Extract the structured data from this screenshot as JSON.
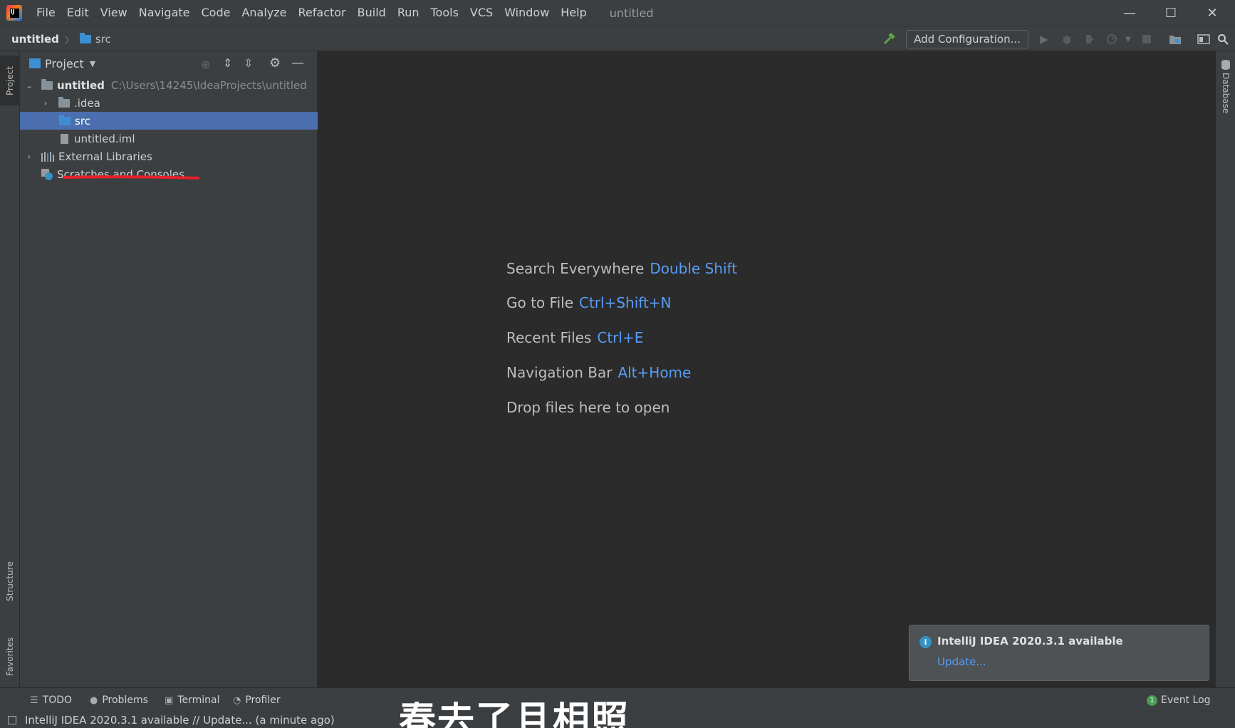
{
  "titlebar": {
    "menu": [
      "File",
      "Edit",
      "View",
      "Navigate",
      "Code",
      "Analyze",
      "Refactor",
      "Build",
      "Run",
      "Tools",
      "VCS",
      "Window",
      "Help"
    ],
    "project_title": "untitled",
    "controls": {
      "minimize": "—",
      "maximize": "☐",
      "close": "✕"
    }
  },
  "navbar": {
    "breadcrumb_root": "untitled",
    "breadcrumb_sep": "〉",
    "breadcrumb_child": "src",
    "add_configuration": "Add Configuration..."
  },
  "leftstrip": {
    "project": "Project",
    "structure": "Structure",
    "favorites": "Favorites"
  },
  "rightstrip": {
    "database": "Database"
  },
  "project_panel": {
    "title": "Project",
    "tree": {
      "root_name": "untitled",
      "root_path": "C:\\Users\\14245\\IdeaProjects\\untitled",
      "idea": ".idea",
      "src": "src",
      "iml": "untitled.iml",
      "external_libraries": "External Libraries",
      "scratches": "Scratches and Consoles"
    }
  },
  "editor": {
    "hints": [
      {
        "label": "Search Everywhere",
        "key": "Double Shift"
      },
      {
        "label": "Go to File",
        "key": "Ctrl+Shift+N"
      },
      {
        "label": "Recent Files",
        "key": "Ctrl+E"
      },
      {
        "label": "Navigation Bar",
        "key": "Alt+Home"
      }
    ],
    "drop_text": "Drop files here to open"
  },
  "notification": {
    "icon": "i",
    "title": "IntelliJ IDEA 2020.3.1 available",
    "link": "Update..."
  },
  "bottom_tools": {
    "todo": "TODO",
    "problems": "Problems",
    "terminal": "Terminal",
    "profiler": "Profiler",
    "event_log": "Event Log",
    "event_log_count": "1"
  },
  "statusbar": {
    "text": "IntelliJ IDEA 2020.3.1 available // Update... (a minute ago)"
  },
  "overlay_caption": "春去了且相照",
  "colors": {
    "accent_blue": "#589df6",
    "selection": "#4b6eaf",
    "annotation_red": "#e8202a"
  }
}
